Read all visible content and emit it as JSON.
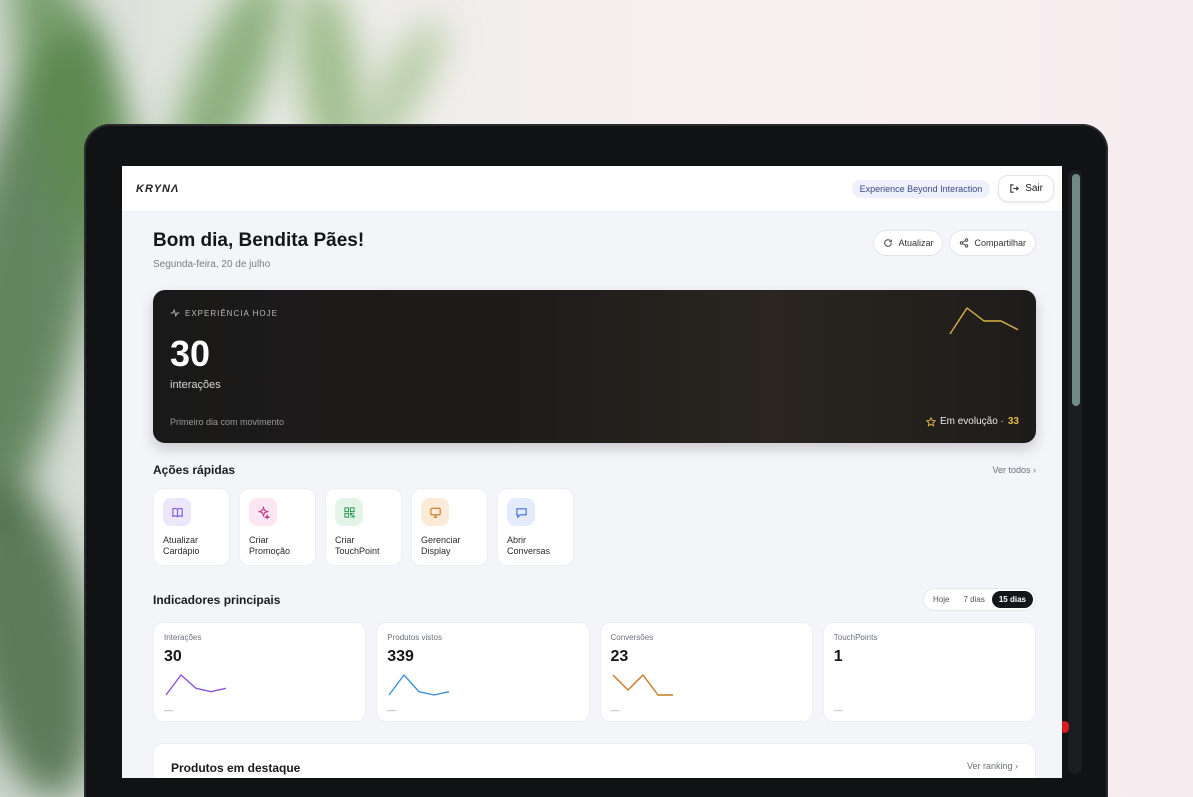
{
  "header": {
    "logo": "KRYNΛ",
    "tagline": "Experience Beyond Interaction",
    "logout_label": "Sair"
  },
  "greeting": {
    "title": "Bom dia, Bendita Pães!",
    "date": "Segunda-feira, 20 de julho",
    "refresh_label": "Atualizar",
    "share_label": "Compartilhar"
  },
  "hero": {
    "label": "EXPERIÊNCIA HOJE",
    "value": "30",
    "unit": "interações",
    "footnote": "Primeiro dia com movimento",
    "badge_text": "Em evolução ·",
    "badge_value": "33",
    "spark_color": "#d9b34a",
    "spark": [
      2,
      8,
      5,
      5,
      3
    ]
  },
  "quick_actions": {
    "title": "Ações rápidas",
    "see_all": "Ver todos ›",
    "items": [
      {
        "line1": "Atualizar",
        "line2": "Cardápio",
        "icon": "book-icon",
        "bg": "#ece6fb",
        "fg": "#7b54d6"
      },
      {
        "line1": "Criar",
        "line2": "Promoção",
        "icon": "sparkle-icon",
        "bg": "#fbe6f1",
        "fg": "#c2408a"
      },
      {
        "line1": "Criar",
        "line2": "TouchPoint",
        "icon": "qr-icon",
        "bg": "#e3f5e8",
        "fg": "#2f9a54"
      },
      {
        "line1": "Gerenciar",
        "line2": "Display",
        "icon": "monitor-icon",
        "bg": "#fcebd9",
        "fg": "#c8731e"
      },
      {
        "line1": "Abrir",
        "line2": "Conversas",
        "icon": "chat-icon",
        "bg": "#e4ecfb",
        "fg": "#3f6fd1"
      }
    ]
  },
  "indicators": {
    "title": "Indicadores principais",
    "ranges": [
      "Hoje",
      "7 dias",
      "15 dias"
    ],
    "active_range": 2,
    "cards": [
      {
        "label": "Interações",
        "value": "30",
        "dash": "—",
        "color": "#8a55d9",
        "spark": [
          2,
          8,
          4,
          3,
          4
        ]
      },
      {
        "label": "Produtos vistos",
        "value": "339",
        "dash": "—",
        "color": "#3b8fd8",
        "spark": [
          2,
          8,
          3,
          2,
          3
        ]
      },
      {
        "label": "Conversões",
        "value": "23",
        "dash": "—",
        "color": "#c77a1f",
        "spark": [
          8,
          2,
          8,
          0,
          0
        ]
      },
      {
        "label": "TouchPoints",
        "value": "1",
        "dash": "—",
        "color": "#cccccc",
        "spark": []
      }
    ]
  },
  "featured": {
    "title": "Produtos em destaque",
    "link": "Ver ranking ›"
  }
}
